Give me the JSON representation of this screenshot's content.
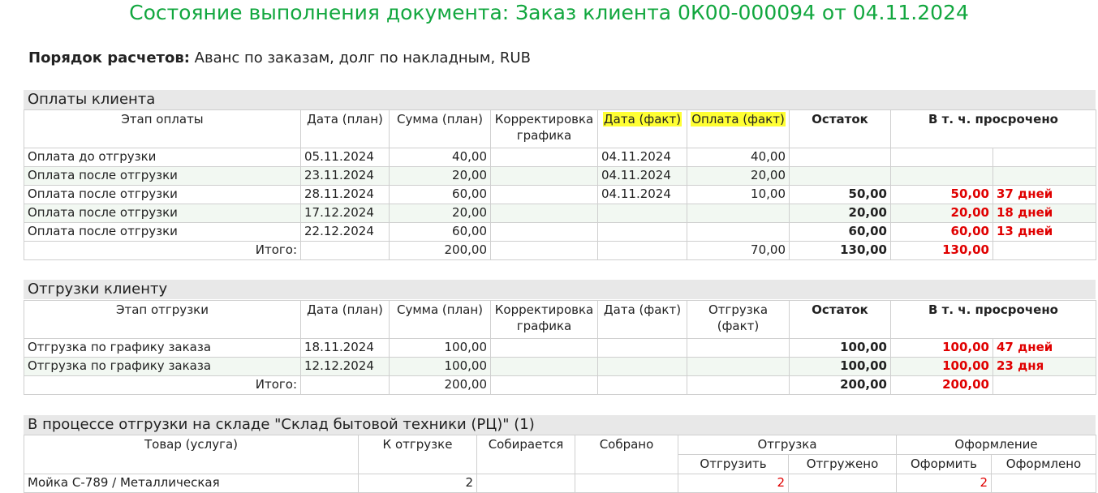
{
  "title": "Состояние выполнения документа: Заказ клиента 0К00-000094 от 04.11.2024",
  "order": {
    "label": "Порядок расчетов:",
    "value": " Аванс по заказам, долг по накладным, RUB"
  },
  "payments": {
    "section": "Оплаты клиента",
    "headers": [
      "Этап оплаты",
      "Дата (план)",
      "Сумма (план)",
      "Корректировка графика",
      "Дата (факт)",
      "Оплата (факт)",
      "Остаток",
      "В т. ч. просрочено"
    ],
    "rows": [
      [
        "Оплата до отгрузки",
        "05.11.2024",
        "40,00",
        "",
        "04.11.2024",
        "40,00",
        "",
        "",
        ""
      ],
      [
        "Оплата после отгрузки",
        "23.11.2024",
        "20,00",
        "",
        "04.11.2024",
        "20,00",
        "",
        "",
        ""
      ],
      [
        "Оплата после отгрузки",
        "28.11.2024",
        "60,00",
        "",
        "04.11.2024",
        "10,00",
        "50,00",
        "50,00",
        "37 дней"
      ],
      [
        "Оплата после отгрузки",
        "17.12.2024",
        "20,00",
        "",
        "",
        "",
        "20,00",
        "20,00",
        "18 дней"
      ],
      [
        "Оплата после отгрузки",
        "22.12.2024",
        "60,00",
        "",
        "",
        "",
        "60,00",
        "60,00",
        "13 дней"
      ]
    ],
    "total": {
      "label": "Итого:",
      "plan": "200,00",
      "fact": "70,00",
      "rest": "130,00",
      "overdue": "130,00"
    }
  },
  "shipments": {
    "section": "Отгрузки клиенту",
    "headers": [
      "Этап отгрузки",
      "Дата (план)",
      "Сумма (план)",
      "Корректировка графика",
      "Дата (факт)",
      "Отгрузка (факт)",
      "Остаток",
      "В т. ч. просрочено"
    ],
    "rows": [
      [
        "Отгрузка по графику заказа",
        "18.11.2024",
        "100,00",
        "",
        "",
        "",
        "100,00",
        "100,00",
        "47 дней"
      ],
      [
        "Отгрузка по графику заказа",
        "12.12.2024",
        "100,00",
        "",
        "",
        "",
        "100,00",
        "100,00",
        "23 дня"
      ]
    ],
    "total": {
      "label": "Итого:",
      "plan": "200,00",
      "rest": "200,00",
      "overdue": "200,00"
    }
  },
  "warehouse": {
    "section": "В процессе отгрузки на складе \"Склад бытовой техники (РЦ)\" (1)",
    "headers": [
      "Товар (услуга)",
      "К отгрузке",
      "Собирается",
      "Собрано",
      "Отгрузка",
      "Оформление"
    ],
    "subheaders": [
      "Отгрузить",
      "Отгружено",
      "Оформить",
      "Оформлено"
    ],
    "row": [
      "Мойка С-789 / Металлическая",
      "2",
      "",
      "",
      "2",
      "",
      "2",
      ""
    ]
  },
  "colors": {
    "title": "#12a73f",
    "overdue": "#e00000",
    "highlight": "#ffff33",
    "section_bg": "#e8e8e8"
  }
}
